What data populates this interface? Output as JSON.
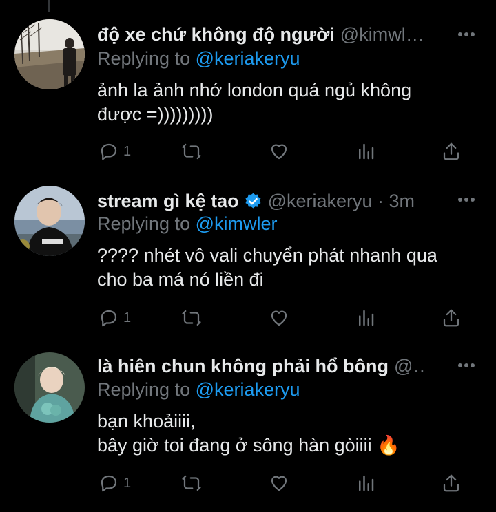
{
  "tweets": [
    {
      "name": "độ xe chứ không độ người",
      "handle": "@kimwler ·…",
      "verified": false,
      "reply_prefix": "Replying to",
      "reply_to": "@keriakeryu",
      "lines": [
        "ảnh la ảnh nhớ london quá ngủ không",
        "được =)))))))))"
      ],
      "reply_count": "1"
    },
    {
      "name": "stream gì kệ tao",
      "handle": "@keriakeryu · 3m",
      "verified": true,
      "reply_prefix": "Replying to",
      "reply_to": "@kimwler",
      "lines": [
        "???? nhét vô vali chuyển phát nhanh qua",
        "cho ba má nó liền đi"
      ],
      "reply_count": "1"
    },
    {
      "name": "là hiên chun không phải hổ bông",
      "handle": "@m…",
      "verified": false,
      "reply_prefix": "Replying to",
      "reply_to": "@keriakeryu",
      "lines": [
        "bạn khoảiiii,",
        "bây giờ toi đang ở sông hàn gòiiii 🔥"
      ],
      "reply_count": "1"
    }
  ],
  "colors": {
    "background": "#000000",
    "text": "#e7e9ea",
    "secondary": "#71767b",
    "accent": "#1d9bf0"
  },
  "icons": [
    "reply-icon",
    "retweet-icon",
    "like-icon",
    "analytics-icon",
    "share-icon",
    "more-icon",
    "verified-icon"
  ]
}
